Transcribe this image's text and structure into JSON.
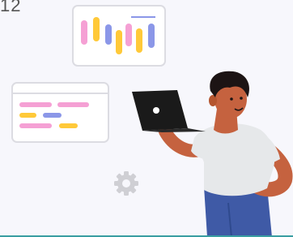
{
  "corner_text": "12",
  "colors": {
    "background": "#f7f7fc",
    "card": "#ffffff",
    "card_border": "#dcdce2",
    "pink": "#f5a0d4",
    "yellow": "#ffc939",
    "blue": "#8b97e8",
    "gear": "#cfcfd4",
    "skin": "#c5623f",
    "hair": "#1c1414",
    "shirt": "#e6e8ea",
    "pants": "#3f5aa6",
    "laptop": "#1a1a1a",
    "bottom_line": "#3a9ea2"
  },
  "icons": [
    "gear-icon",
    "laptop-logo-icon"
  ]
}
